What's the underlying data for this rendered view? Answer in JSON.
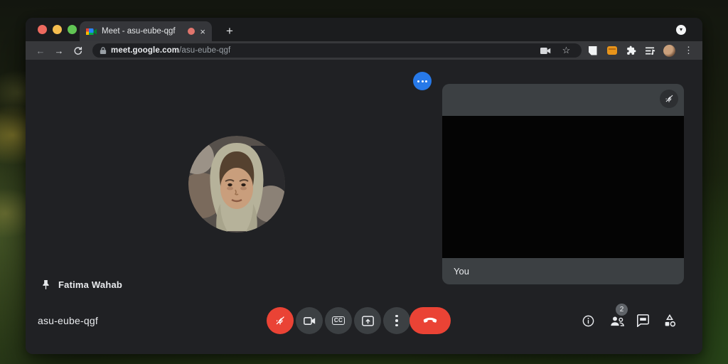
{
  "browser": {
    "tab": {
      "title": "Meet - asu-eube-qgf"
    },
    "url": {
      "domain": "meet.google.com",
      "path": "/asu-eube-qgf"
    }
  },
  "icons": {
    "back": "←",
    "forward": "→",
    "close": "×",
    "new_tab": "+",
    "tab_search_caret": "▾",
    "star": "☆",
    "menu_vertical": "⋮"
  },
  "meet": {
    "pinned_participant": "Fatima Wahab",
    "meeting_code": "asu-eube-qgf",
    "self_view_label": "You",
    "participants_badge": "2",
    "captions_label": "CC"
  },
  "colors": {
    "surface": "#202124",
    "tile_strip": "#3c4043",
    "toolbar": "#37383b",
    "meet_red": "#ea4335",
    "more_blue": "#2779e8",
    "badge_gray": "#5f6368",
    "traffic_red": "#ee6a5f",
    "traffic_yellow": "#f5bd4f",
    "traffic_green": "#61c554",
    "recording_dot": "#e0756d",
    "honey_orange": "#e8941a"
  }
}
